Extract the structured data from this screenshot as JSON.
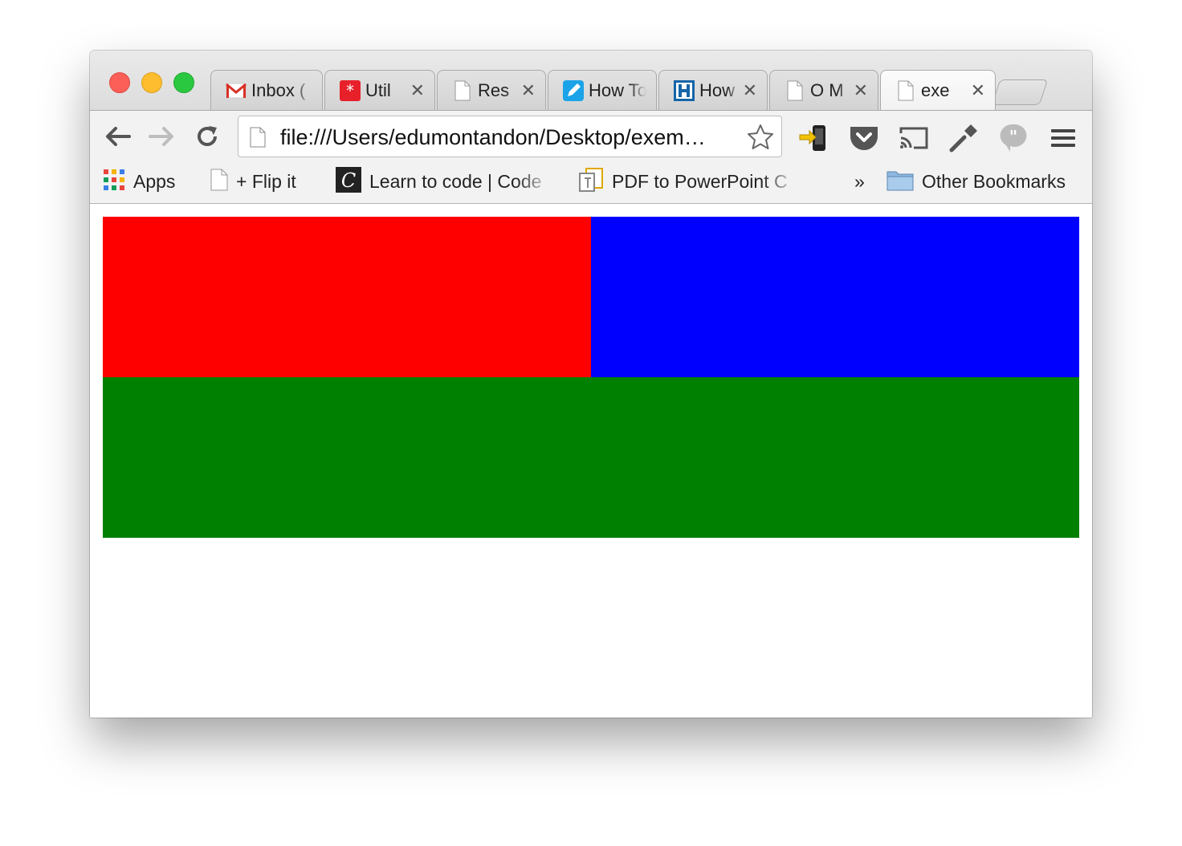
{
  "browser": {
    "tabs": [
      {
        "title": "Inbox (",
        "favicon": "gmail-icon",
        "active": false
      },
      {
        "title": "Util",
        "favicon": "asterisk-app-icon",
        "active": false
      },
      {
        "title": "Res",
        "favicon": "document-icon",
        "active": false
      },
      {
        "title": "How To",
        "favicon": "pencil-icon",
        "active": false
      },
      {
        "title": "How",
        "favicon": "h-logo-icon",
        "active": false
      },
      {
        "title": "O M",
        "favicon": "document-icon",
        "active": false
      },
      {
        "title": "exe",
        "favicon": "document-icon",
        "active": true
      }
    ],
    "close_glyph": "✕",
    "url": "file:///Users/edumontandon/Desktop/exem…"
  },
  "bookmarks": {
    "items": [
      {
        "label": "Apps",
        "icon": "apps-grid-icon"
      },
      {
        "label": "+ Flip it",
        "icon": "document-icon"
      },
      {
        "label": "Learn to code | Code",
        "icon": "codecademy-icon"
      },
      {
        "label": "PDF to PowerPoint C",
        "icon": "pdf-convert-icon"
      }
    ],
    "overflow_label": "»",
    "other_label": "Other Bookmarks"
  },
  "page": {
    "colors": {
      "top_left": "#ff0000",
      "top_right": "#0000ff",
      "bottom": "#008000"
    }
  }
}
